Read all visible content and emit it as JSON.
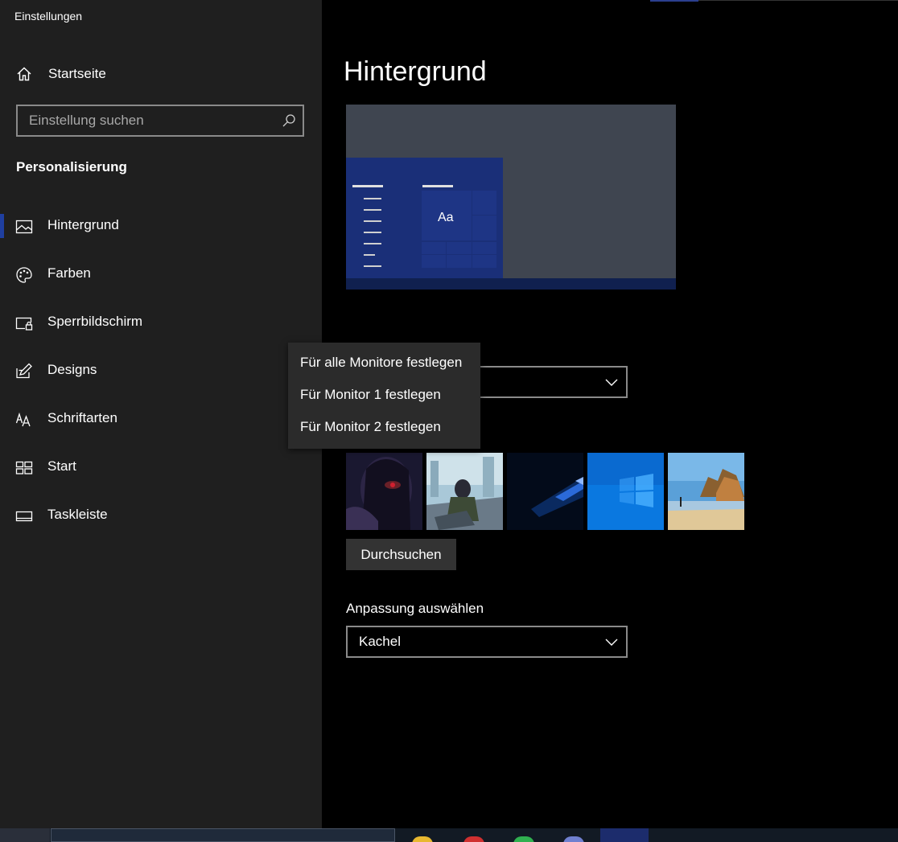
{
  "app": {
    "title": "Einstellungen"
  },
  "sidebar": {
    "home_label": "Startseite",
    "search_placeholder": "Einstellung suchen",
    "section": "Personalisierung",
    "items": [
      {
        "label": "Hintergrund",
        "icon": "picture-icon",
        "selected": true
      },
      {
        "label": "Farben",
        "icon": "palette-icon",
        "selected": false
      },
      {
        "label": "Sperrbildschirm",
        "icon": "lock-screen-icon",
        "selected": false
      },
      {
        "label": "Designs",
        "icon": "designs-icon",
        "selected": false
      },
      {
        "label": "Schriftarten",
        "icon": "fonts-icon",
        "selected": false
      },
      {
        "label": "Start",
        "icon": "start-icon",
        "selected": false
      },
      {
        "label": "Taskleiste",
        "icon": "taskbar-icon",
        "selected": false
      }
    ]
  },
  "main": {
    "title": "Hintergrund",
    "preview_sample": "Aa",
    "browse_label": "Durchsuchen",
    "fit_label": "Anpassung auswählen",
    "fit_value": "Kachel"
  },
  "context_menu": {
    "items": [
      "Für alle Monitore festlegen",
      "Für Monitor 1 festlegen",
      "Für Monitor 2 festlegen"
    ]
  },
  "colors": {
    "accent": "#1f3fa0",
    "sidebar_bg": "#1f1f1f",
    "preview_bg": "#3f4550",
    "preview_start": "#1a2f78"
  }
}
